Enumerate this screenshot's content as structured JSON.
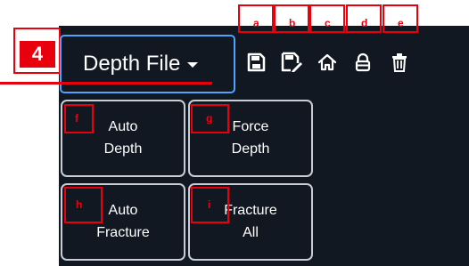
{
  "depth_file": {
    "label": "Depth File"
  },
  "callout_main": {
    "number": "4"
  },
  "toolbar": {
    "tags": [
      "a",
      "b",
      "c",
      "d",
      "e"
    ],
    "icons": [
      "save-icon",
      "save-as-icon",
      "home-icon",
      "lock-icon",
      "trash-icon"
    ]
  },
  "actions": [
    {
      "tag": "f",
      "line1": "Auto",
      "line2": "Depth"
    },
    {
      "tag": "g",
      "line1": "Force",
      "line2": "Depth"
    },
    {
      "tag": "h",
      "line1": "Auto",
      "line2": "Fracture"
    },
    {
      "tag": "i",
      "line1": "Fracture",
      "line2": "All"
    }
  ],
  "colors": {
    "panel_bg": "#111821",
    "callout_red": "#e8000d",
    "focus_blue": "#4da3ff",
    "button_border": "#c9ced5",
    "text": "#ffffff"
  }
}
